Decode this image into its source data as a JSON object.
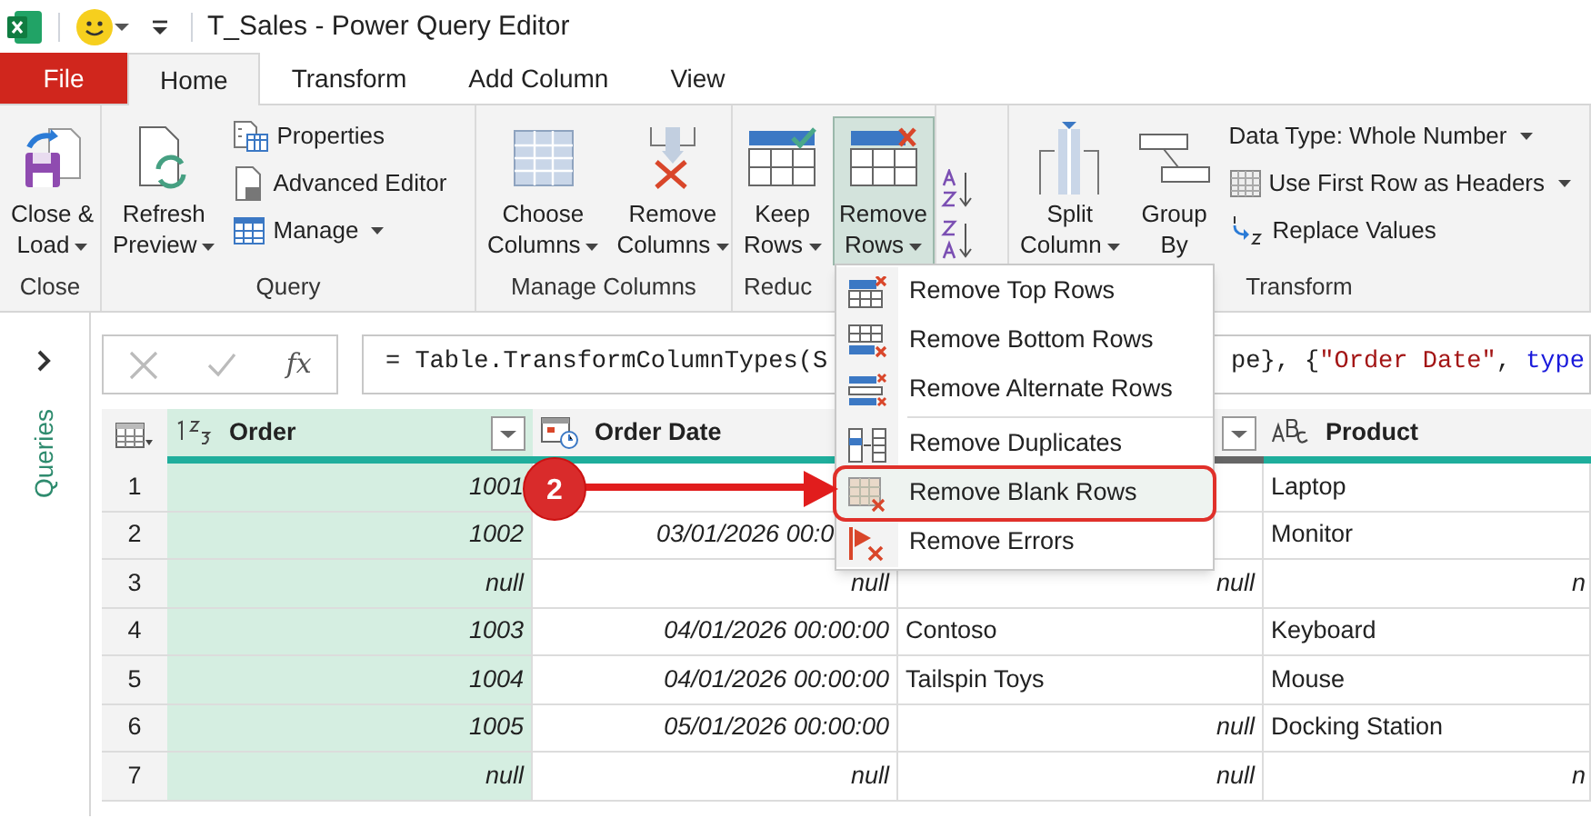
{
  "title_bar": {
    "title": "T_Sales - Power Query Editor"
  },
  "tabs": [
    {
      "label": "File",
      "kind": "file",
      "selected": false
    },
    {
      "label": "Home",
      "kind": "tab",
      "selected": true
    },
    {
      "label": "Transform",
      "kind": "tab",
      "selected": false
    },
    {
      "label": "Add Column",
      "kind": "tab",
      "selected": false
    },
    {
      "label": "View",
      "kind": "tab",
      "selected": false
    }
  ],
  "ribbon": {
    "groups": [
      {
        "label": "Close",
        "large": [
          {
            "lines": [
              "Close &",
              "Load"
            ],
            "dropdown": true,
            "pressed": false
          }
        ]
      },
      {
        "label": "Query",
        "large": [
          {
            "lines": [
              "Refresh",
              "Preview"
            ],
            "dropdown": true,
            "pressed": false
          }
        ],
        "small": [
          {
            "label": "Properties",
            "dropdown": false
          },
          {
            "label": "Advanced Editor",
            "dropdown": false
          },
          {
            "label": "Manage",
            "dropdown": true
          }
        ]
      },
      {
        "label": "Manage Columns",
        "large": [
          {
            "lines": [
              "Choose",
              "Columns"
            ],
            "dropdown": true,
            "pressed": false
          },
          {
            "lines": [
              "Remove",
              "Columns"
            ],
            "dropdown": true,
            "pressed": false
          }
        ]
      },
      {
        "label": "Reduc",
        "large": [
          {
            "lines": [
              "Keep",
              "Rows"
            ],
            "dropdown": true,
            "pressed": false
          },
          {
            "lines": [
              "Remove",
              "Rows"
            ],
            "dropdown": true,
            "pressed": true
          }
        ]
      },
      {
        "kind": "sort"
      },
      {
        "label": "Transform",
        "large": [
          {
            "lines": [
              "Split",
              "Column"
            ],
            "dropdown": true,
            "pressed": false
          },
          {
            "lines": [
              "Group",
              "By"
            ],
            "dropdown": false,
            "pressed": false
          }
        ],
        "small": [
          {
            "label": "Data Type: Whole Number",
            "dropdown": true
          },
          {
            "label": "Use First Row as Headers",
            "dropdown": true
          },
          {
            "label": "Replace Values",
            "dropdown": false
          }
        ]
      }
    ]
  },
  "queries_panel": {
    "label": "Queries"
  },
  "formula_bar": {
    "function_label": "fx",
    "segments": [
      {
        "text": "= Table.TransformColumnTypes(S",
        "kind": "plain"
      },
      {
        "text": "pe}, {",
        "kind": "plain",
        "gap": true
      },
      {
        "text": "\"Order Date\"",
        "kind": "string"
      },
      {
        "text": ", ",
        "kind": "plain"
      },
      {
        "text": "type",
        "kind": "keyword"
      }
    ]
  },
  "table": {
    "columns": [
      {
        "label": "Order",
        "kind": "number",
        "highlighted": true
      },
      {
        "label": "Order Date",
        "kind": "datetime",
        "highlighted": false
      },
      {
        "kind": "covered",
        "highlighted": false
      },
      {
        "label": "Product",
        "kind": "text",
        "highlighted": false
      }
    ],
    "rows": [
      {
        "num": "1",
        "cells": [
          {
            "text": "1001",
            "kind": "value"
          },
          null,
          null,
          {
            "text": "Laptop",
            "kind": "text"
          }
        ]
      },
      {
        "num": "2",
        "cells": [
          {
            "text": "1002",
            "kind": "value"
          },
          {
            "text": "03/01/2026 00:0",
            "kind": "clipped"
          },
          null,
          {
            "text": "Monitor",
            "kind": "text"
          }
        ]
      },
      {
        "num": "3",
        "cells": [
          {
            "text": "null",
            "kind": "value"
          },
          {
            "text": "null",
            "kind": "value"
          },
          {
            "text": "null",
            "kind": "value"
          },
          {
            "text": "n",
            "kind": "edge"
          }
        ]
      },
      {
        "num": "4",
        "cells": [
          {
            "text": "1003",
            "kind": "value"
          },
          {
            "text": "04/01/2026 00:00:00",
            "kind": "value"
          },
          {
            "text": "Contoso",
            "kind": "text"
          },
          {
            "text": "Keyboard",
            "kind": "text"
          }
        ]
      },
      {
        "num": "5",
        "cells": [
          {
            "text": "1004",
            "kind": "value"
          },
          {
            "text": "04/01/2026 00:00:00",
            "kind": "value"
          },
          {
            "text": "Tailspin Toys",
            "kind": "text"
          },
          {
            "text": "Mouse",
            "kind": "text"
          }
        ]
      },
      {
        "num": "6",
        "cells": [
          {
            "text": "1005",
            "kind": "value"
          },
          {
            "text": "05/01/2026 00:00:00",
            "kind": "value"
          },
          {
            "text": "null",
            "kind": "value"
          },
          {
            "text": "Docking Station",
            "kind": "text"
          }
        ]
      },
      {
        "num": "7",
        "cells": [
          {
            "text": "null",
            "kind": "value"
          },
          {
            "text": "null",
            "kind": "value"
          },
          {
            "text": "null",
            "kind": "value"
          },
          {
            "text": "n",
            "kind": "edge"
          }
        ]
      }
    ]
  },
  "menu": {
    "items": [
      {
        "kind": "item",
        "label": "Remove Top Rows",
        "highlighted": false
      },
      {
        "kind": "item",
        "label": "Remove Bottom Rows",
        "highlighted": false
      },
      {
        "kind": "item",
        "label": "Remove Alternate Rows",
        "highlighted": false
      },
      {
        "kind": "separator"
      },
      {
        "kind": "item",
        "label": "Remove Duplicates",
        "highlighted": false
      },
      {
        "kind": "item",
        "label": "Remove Blank Rows",
        "highlighted": true
      },
      {
        "kind": "item",
        "label": "Remove Errors",
        "highlighted": false
      }
    ]
  },
  "callout": {
    "label": "2"
  }
}
